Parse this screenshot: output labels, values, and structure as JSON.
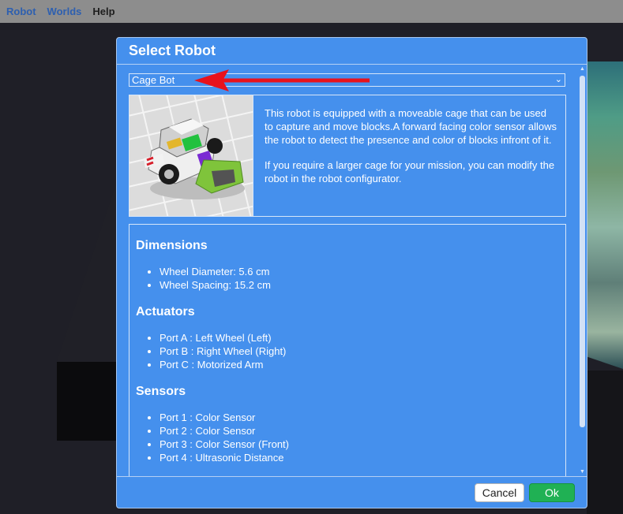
{
  "menubar": {
    "robot": "Robot",
    "worlds": "Worlds",
    "help": "Help"
  },
  "dialog": {
    "title": "Select Robot",
    "select_value": "Cage Bot",
    "description": [
      "This robot is equipped with a moveable cage that can be used to capture and move blocks.A forward facing color sensor allows the robot to detect the presence and color of blocks infront of it.",
      "If you require a larger cage for your mission, you can modify the robot in the robot configurator."
    ],
    "sections": [
      {
        "title": "Dimensions",
        "items": [
          "Wheel Diameter: 5.6 cm",
          "Wheel Spacing: 15.2 cm"
        ]
      },
      {
        "title": "Actuators",
        "items": [
          "Port A : Left Wheel (Left)",
          "Port B : Right Wheel (Right)",
          "Port C : Motorized Arm"
        ]
      },
      {
        "title": "Sensors",
        "items": [
          "Port 1 : Color Sensor",
          "Port 2 : Color Sensor",
          "Port 3 : Color Sensor (Front)",
          "Port 4 : Ultrasonic Distance"
        ]
      }
    ],
    "buttons": {
      "cancel": "Cancel",
      "ok": "Ok"
    }
  },
  "colors": {
    "dialog_bg": "#4590ed",
    "ok_button": "#20b154",
    "annotation_arrow": "#e8121c"
  },
  "icons": [
    "chevron-down-icon",
    "scroll-up-icon",
    "scroll-down-icon",
    "annotation-arrow"
  ]
}
